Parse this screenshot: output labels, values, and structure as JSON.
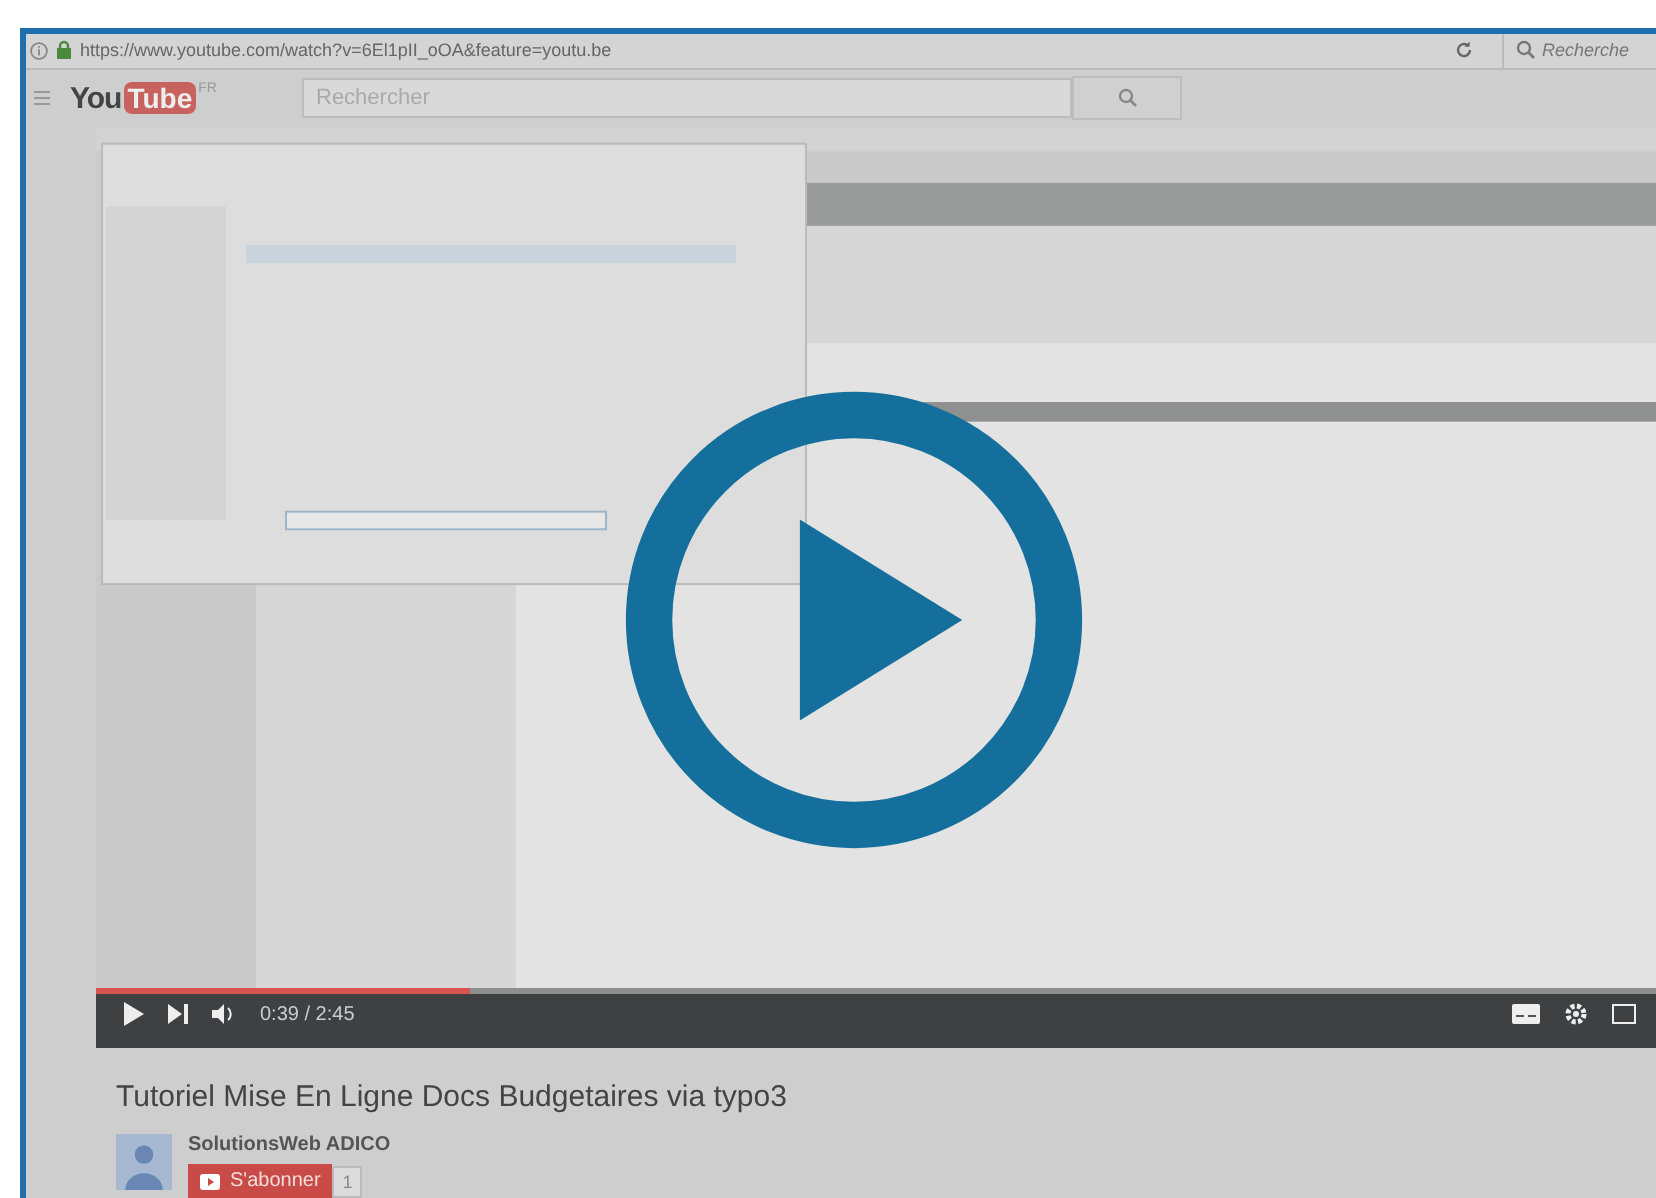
{
  "address_bar": {
    "url": "https://www.youtube.com/watch?v=6El1pII_oOA&feature=youtu.be",
    "search_placeholder": "Recherche"
  },
  "header": {
    "logo_you": "You",
    "logo_tube": "Tube",
    "region": "FR",
    "search_placeholder": "Rechercher"
  },
  "player": {
    "kind": "picture",
    "progress": {
      "level": 0.24
    },
    "time": "0:39 / 2:45"
  },
  "video": {
    "title": "Tutoriel Mise En Ligne Docs Budgetaires via typo3",
    "channel": "SolutionsWeb ADICO",
    "subscribe_label": "S'abonner",
    "subscriber_count": "1"
  }
}
